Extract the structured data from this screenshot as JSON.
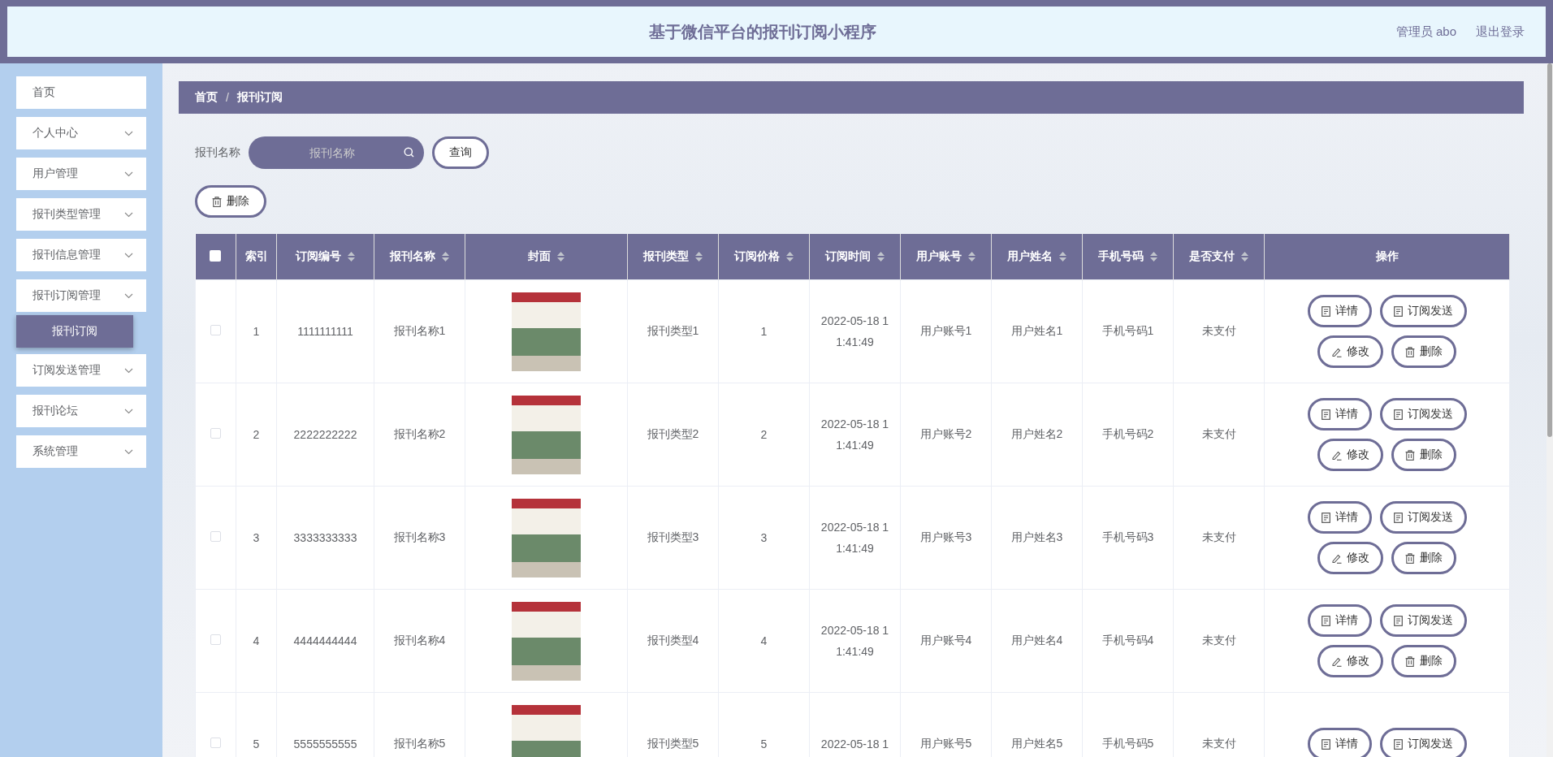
{
  "header": {
    "title": "基于微信平台的报刊订阅小程序",
    "user": "管理员 abo",
    "logout": "退出登录"
  },
  "sidebar": {
    "items": [
      {
        "label": "首页",
        "kind": "link",
        "selected": false
      },
      {
        "label": "个人中心",
        "kind": "group",
        "selected": false
      },
      {
        "label": "用户管理",
        "kind": "group",
        "selected": false
      },
      {
        "label": "报刊类型管理",
        "kind": "group",
        "selected": false
      },
      {
        "label": "报刊信息管理",
        "kind": "group",
        "selected": false
      },
      {
        "label": "报刊订阅管理",
        "kind": "group",
        "selected": false,
        "children": [
          {
            "label": "报刊订阅",
            "selected": true
          }
        ]
      },
      {
        "label": "订阅发送管理",
        "kind": "group",
        "selected": false
      },
      {
        "label": "报刊论坛",
        "kind": "group",
        "selected": false
      },
      {
        "label": "系统管理",
        "kind": "group",
        "selected": false
      }
    ]
  },
  "breadcrumb": {
    "items": [
      "首页",
      "报刊订阅"
    ],
    "separator": "/"
  },
  "search": {
    "label": "报刊名称",
    "placeholder": "报刊名称",
    "button": "查询"
  },
  "delete_button": "删除",
  "table": {
    "select_all": {
      "checked": false
    },
    "columns": [
      {
        "label": "索引",
        "sortable": false
      },
      {
        "label": "订阅编号",
        "sortable": true
      },
      {
        "label": "报刊名称",
        "sortable": true
      },
      {
        "label": "封面",
        "sortable": true
      },
      {
        "label": "报刊类型",
        "sortable": true
      },
      {
        "label": "订阅价格",
        "sortable": true
      },
      {
        "label": "订阅时间",
        "sortable": true
      },
      {
        "label": "用户账号",
        "sortable": true
      },
      {
        "label": "用户姓名",
        "sortable": true
      },
      {
        "label": "手机号码",
        "sortable": true
      },
      {
        "label": "是否支付",
        "sortable": true
      },
      {
        "label": "操作",
        "sortable": false
      }
    ],
    "rows": [
      {
        "checked": false,
        "cells": [
          "1",
          "1111111111",
          "报刊名称1",
          null,
          "报刊类型1",
          "1",
          "2022-05-18 11:41:49",
          "用户账号1",
          "用户姓名1",
          "手机号码1",
          "未支付"
        ],
        "actions": [
          {
            "label": "详情",
            "kind": "doc"
          },
          {
            "label": "订阅发送",
            "kind": "doc"
          },
          {
            "label": "修改",
            "kind": "edit"
          },
          {
            "label": "删除",
            "kind": "delete"
          }
        ]
      },
      {
        "checked": false,
        "cells": [
          "2",
          "2222222222",
          "报刊名称2",
          null,
          "报刊类型2",
          "2",
          "2022-05-18 11:41:49",
          "用户账号2",
          "用户姓名2",
          "手机号码2",
          "未支付"
        ],
        "actions": [
          {
            "label": "详情",
            "kind": "doc"
          },
          {
            "label": "订阅发送",
            "kind": "doc"
          },
          {
            "label": "修改",
            "kind": "edit"
          },
          {
            "label": "删除",
            "kind": "delete"
          }
        ]
      },
      {
        "checked": false,
        "cells": [
          "3",
          "3333333333",
          "报刊名称3",
          null,
          "报刊类型3",
          "3",
          "2022-05-18 11:41:49",
          "用户账号3",
          "用户姓名3",
          "手机号码3",
          "未支付"
        ],
        "actions": [
          {
            "label": "详情",
            "kind": "doc"
          },
          {
            "label": "订阅发送",
            "kind": "doc"
          },
          {
            "label": "修改",
            "kind": "edit"
          },
          {
            "label": "删除",
            "kind": "delete"
          }
        ]
      },
      {
        "checked": false,
        "cells": [
          "4",
          "4444444444",
          "报刊名称4",
          null,
          "报刊类型4",
          "4",
          "2022-05-18 11:41:49",
          "用户账号4",
          "用户姓名4",
          "手机号码4",
          "未支付"
        ],
        "actions": [
          {
            "label": "详情",
            "kind": "doc"
          },
          {
            "label": "订阅发送",
            "kind": "doc"
          },
          {
            "label": "修改",
            "kind": "edit"
          },
          {
            "label": "删除",
            "kind": "delete"
          }
        ]
      },
      {
        "checked": false,
        "cells": [
          "5",
          "5555555555",
          "报刊名称5",
          null,
          "报刊类型5",
          "5",
          "2022-05-18 1",
          "用户账号5",
          "用户姓名5",
          "手机号码5",
          "未支付"
        ],
        "actions": [
          {
            "label": "详情",
            "kind": "doc"
          },
          {
            "label": "订阅发送",
            "kind": "doc"
          }
        ]
      }
    ]
  }
}
